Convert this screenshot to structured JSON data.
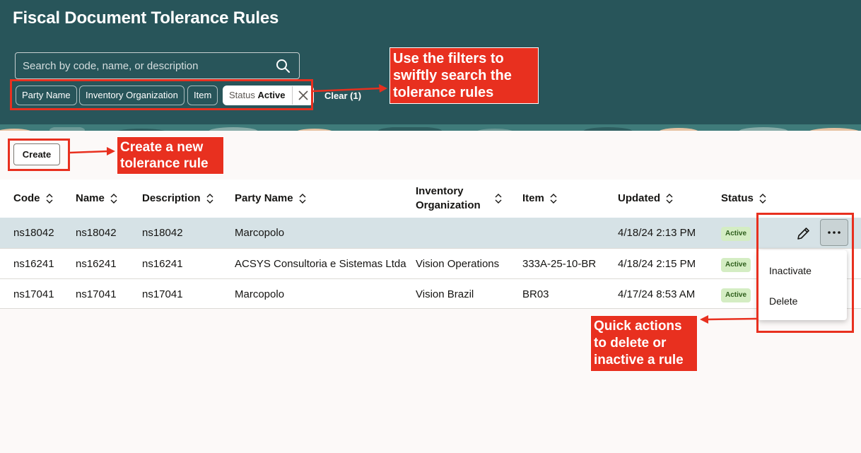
{
  "header": {
    "title": "Fiscal Document Tolerance Rules",
    "search": {
      "placeholder": "Search by code, name, or description",
      "value": ""
    },
    "filters": [
      "Party Name",
      "Inventory Organization",
      "Item"
    ],
    "active_filter": {
      "label": "Status",
      "value": "Active"
    },
    "clear_label": "Clear (1)"
  },
  "toolbar": {
    "create_label": "Create"
  },
  "table": {
    "columns": {
      "code": "Code",
      "name": "Name",
      "description": "Description",
      "party_name": "Party Name",
      "inventory_org_line1": "Inventory",
      "inventory_org_line2": "Organization",
      "item": "Item",
      "updated": "Updated",
      "status": "Status"
    },
    "rows": [
      {
        "code": "ns18042",
        "name": "ns18042",
        "description": "ns18042",
        "party_name": "Marcopolo",
        "inventory_org": "",
        "item": "",
        "updated": "4/18/24 2:13 PM",
        "status": "Active"
      },
      {
        "code": "ns16241",
        "name": "ns16241",
        "description": "ns16241",
        "party_name": "ACSYS Consultoria e Sistemas Ltda",
        "inventory_org": "Vision Operations",
        "item": "333A-25-10-BR",
        "updated": "4/18/24 2:15 PM",
        "status": "Active"
      },
      {
        "code": "ns17041",
        "name": "ns17041",
        "description": "ns17041",
        "party_name": "Marcopolo",
        "inventory_org": "Vision Brazil",
        "item": "BR03",
        "updated": "4/17/24 8:53 AM",
        "status": "Active"
      }
    ]
  },
  "row_menu": {
    "items": [
      "Inactivate",
      "Delete"
    ]
  },
  "annotations": {
    "filters": [
      "Use the filters to",
      "swiftly search the",
      "tolerance rules"
    ],
    "create": [
      "Create a new",
      "tolerance rule"
    ],
    "actions": [
      "Quick actions",
      "to delete or",
      "inactive a rule"
    ]
  },
  "colors": {
    "header_bg": "#28555a",
    "page_bg": "#fcf9f8",
    "selected_row": "#d6e2e6",
    "status_badge_bg": "#d4edc3",
    "status_badge_text": "#2d5d1b",
    "annotation_red": "#e8301f"
  },
  "icons": [
    "search-icon",
    "close-icon",
    "sort-icon",
    "pencil-icon",
    "more-horizontal-icon",
    "arrow-icon"
  ]
}
